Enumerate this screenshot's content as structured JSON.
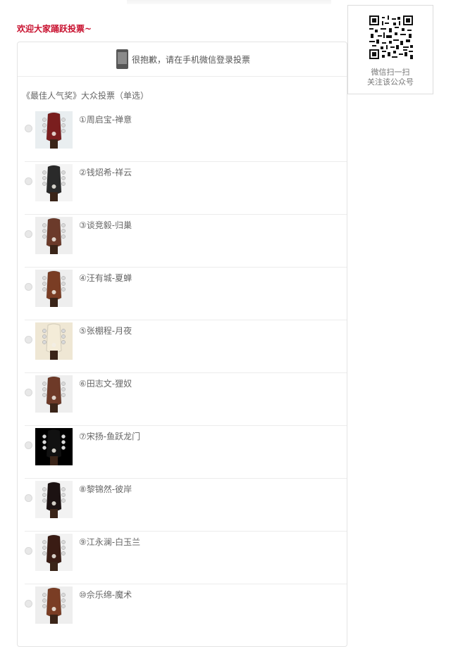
{
  "header": {
    "welcome": "欢迎大家踊跃投票~"
  },
  "qr": {
    "line1": "微信扫一扫",
    "line2": "关注该公众号"
  },
  "login": {
    "message": "很抱歉，请在手机微信登录投票"
  },
  "vote": {
    "title": "《最佳人气奖》大众投票（单选）",
    "options": [
      {
        "label": "①周启宝-禅意",
        "head_color": "#7a1e1e",
        "bg": "#e9eef0"
      },
      {
        "label": "②钱炤希-祥云",
        "head_color": "#2a2a2a",
        "bg": "#f4f4f4"
      },
      {
        "label": "③谈竞毅-归巢",
        "head_color": "#6b3a2a",
        "bg": "#eeeeee"
      },
      {
        "label": "④汪有城-夏蝉",
        "head_color": "#7a3d24",
        "bg": "#eeeeee"
      },
      {
        "label": "⑤张棚程-月夜",
        "head_color": "#f4ecd8",
        "bg": "#efe7d4"
      },
      {
        "label": "⑥田志文-狸奴",
        "head_color": "#6e3a28",
        "bg": "#eeeeee"
      },
      {
        "label": "⑦宋扬-鱼跃龙门",
        "head_color": "#111111",
        "bg": "#000000"
      },
      {
        "label": "⑧黎锦然-彼岸",
        "head_color": "#1c1212",
        "bg": "#f2f2f2"
      },
      {
        "label": "⑨江永澜-白玉兰",
        "head_color": "#3a1c14",
        "bg": "#f2f2f2"
      },
      {
        "label": "⑩佘乐绵-魔术",
        "head_color": "#7a3d24",
        "bg": "#eeeeee"
      }
    ]
  }
}
